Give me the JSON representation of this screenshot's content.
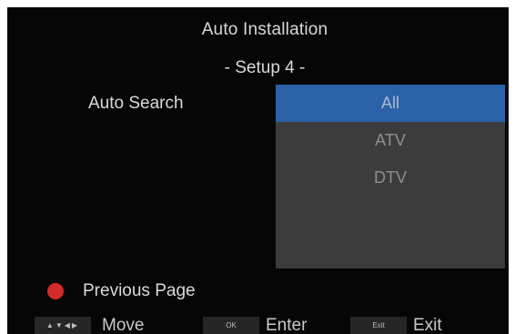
{
  "header": {
    "title": "Auto Installation",
    "subtitle": "- Setup 4 -"
  },
  "setting": {
    "label": "Auto Search"
  },
  "dropdown": {
    "options": [
      "All",
      "ATV",
      "DTV"
    ],
    "selected": "All"
  },
  "navigation": {
    "previous_page": "Previous Page"
  },
  "footer": {
    "move_key": "▲▼◀▶",
    "move_label": "Move",
    "ok_key": "OK",
    "enter_label": "Enter",
    "exit_key": "Exit",
    "exit_label": "Exit"
  },
  "colors": {
    "background": "#060606",
    "highlight": "#2b62a7",
    "panel": "#3c3c3c",
    "red_button": "#d22b2b"
  }
}
